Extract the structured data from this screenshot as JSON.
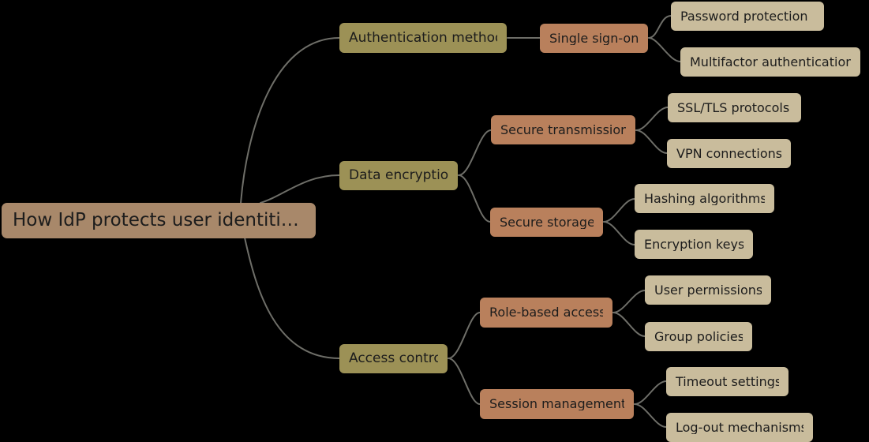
{
  "diagram": {
    "type": "mind-map",
    "title": "How IdP protects user identities",
    "background_color": "#000000",
    "connector_color": "#6e6e68",
    "levels": {
      "root_color": "#a8886a",
      "level1_color": "#9c9156",
      "level2_color": "#b9805c",
      "level3_color": "#c9bc9c"
    }
  },
  "nodes": {
    "root": {
      "label": "How IdP protects user identiti…"
    },
    "authentication_methods": {
      "label": "Authentication methods"
    },
    "single_sign_on": {
      "label": "Single sign-on"
    },
    "password_protection": {
      "label": "Password protection"
    },
    "multifactor_authentication": {
      "label": "Multifactor authentication"
    },
    "data_encryption": {
      "label": "Data encryption"
    },
    "secure_transmission": {
      "label": "Secure transmission"
    },
    "ssl_tls_protocols": {
      "label": "SSL/TLS protocols"
    },
    "vpn_connections": {
      "label": "VPN connections"
    },
    "secure_storage": {
      "label": "Secure storage"
    },
    "hashing_algorithms": {
      "label": "Hashing algorithms"
    },
    "encryption_keys": {
      "label": "Encryption keys"
    },
    "access_control": {
      "label": "Access control"
    },
    "role_based_access": {
      "label": "Role-based access"
    },
    "user_permissions": {
      "label": "User permissions"
    },
    "group_policies": {
      "label": "Group policies"
    },
    "session_management": {
      "label": "Session management"
    },
    "timeout_settings": {
      "label": "Timeout settings"
    },
    "log_out_mechanisms": {
      "label": "Log-out mechanisms"
    }
  }
}
